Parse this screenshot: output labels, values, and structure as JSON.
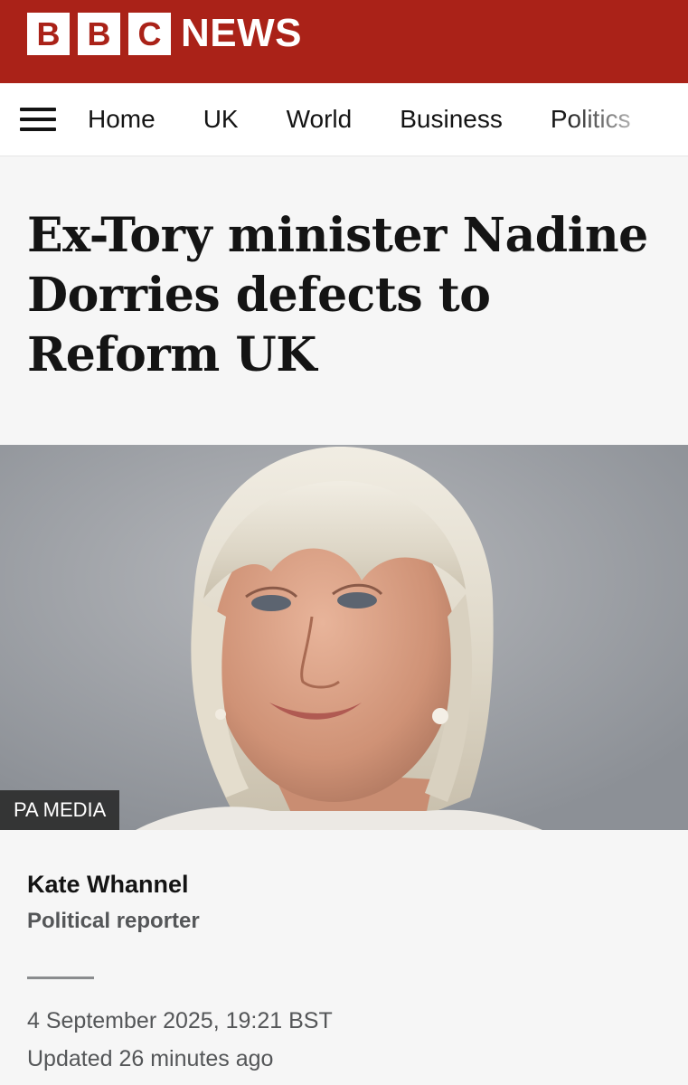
{
  "header": {
    "logo_letters": [
      "B",
      "B",
      "C"
    ],
    "brand_word": "NEWS",
    "brand_color": "#aa2218"
  },
  "nav": {
    "menu_icon": "hamburger-menu-icon",
    "items": [
      {
        "label": "Home"
      },
      {
        "label": "UK"
      },
      {
        "label": "World"
      },
      {
        "label": "Business"
      },
      {
        "label": "Politics"
      }
    ]
  },
  "article": {
    "headline": "Ex-Tory minister Nadine Dorries defects to Reform UK",
    "image_credit": "PA MEDIA",
    "author": "Kate Whannel",
    "author_role": "Political reporter",
    "published": "4 September 2025, 19:21 BST",
    "updated": "Updated 26 minutes ago"
  }
}
